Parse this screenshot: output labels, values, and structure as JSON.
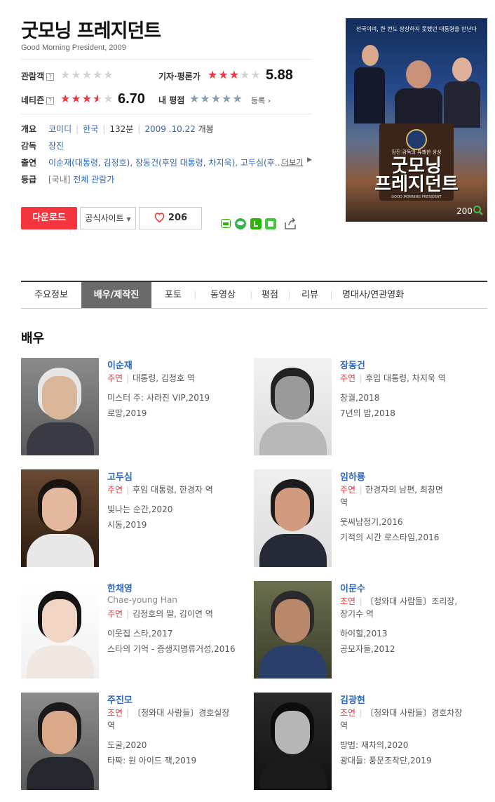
{
  "movie": {
    "title": "굿모닝 프레지던트",
    "subtitle": "Good Morning President, 2009"
  },
  "ratings": {
    "audience_label": "관람객",
    "critic_label": "기자·평론가",
    "critic_score": "5.88",
    "critic_stars": 3.0,
    "netizen_label": "네티즌",
    "netizen_score": "6.70",
    "netizen_stars": 3.5,
    "my_label": "내 평점",
    "register_label": "등록",
    "help_mark": "?"
  },
  "info": {
    "summary_key": "개요",
    "genre": "코미디",
    "country": "한국",
    "runtime": "132분",
    "release_date": "2009 .10.22",
    "release_suffix": "개봉",
    "director_key": "감독",
    "director": "장진",
    "cast_key": "출연",
    "cast_1": "이순재",
    "cast_1_role": "(대통령, 김정호),",
    "cast_2": "장동건",
    "cast_2_role": "(후임 대통령, 차지욱),",
    "cast_3": "고두심",
    "cast_3_role": "(후…",
    "more_label": "더보기",
    "grade_key": "등급",
    "grade_country": "[국내]",
    "grade": "전체 관람가"
  },
  "actions": {
    "download": "다운로드",
    "official_site": "공식사이트",
    "likes": "206"
  },
  "poster": {
    "top_text": "전국이며, 한 번도 상상하지 못했던 대통령을 만난다",
    "seal_text": "장진 감독의 유쾌한 상상",
    "title_line1": "굿모닝",
    "title_line2": "프레지던트",
    "en_title": "GOOD MORNING PRESIDENT",
    "year_partial": "200"
  },
  "tabs": [
    {
      "label": "주요정보"
    },
    {
      "label": "배우/제작진"
    },
    {
      "label": "포토"
    },
    {
      "label": "동영상"
    },
    {
      "label": "평점"
    },
    {
      "label": "리뷰"
    },
    {
      "label": "명대사/연관영화"
    }
  ],
  "section": {
    "title": "배우"
  },
  "actors": [
    {
      "name": "이순재",
      "en": "",
      "type": "주연",
      "role": "대통령, 김정호 역",
      "role2": "",
      "works": [
        "미스터 주: 사라진 VIP,2019",
        "로망,2019"
      ]
    },
    {
      "name": "장동건",
      "en": "",
      "type": "주연",
      "role": "후임 대통령, 차지욱 역",
      "role2": "",
      "works": [
        "창궐,2018",
        "7년의 밤,2018"
      ]
    },
    {
      "name": "고두심",
      "en": "",
      "type": "주연",
      "role": "후임 대통령, 한경자 역",
      "role2": "",
      "works": [
        "빛나는 순간,2020",
        "시동,2019"
      ]
    },
    {
      "name": "임하룡",
      "en": "",
      "type": "주연",
      "role": "한경자의 남편, 최창면",
      "role2": "역",
      "works": [
        "웃씨남정기,2016",
        "기적의 시간 로스타임,2016"
      ]
    },
    {
      "name": "한채영",
      "en": "Chae-young Han",
      "type": "주연",
      "role": "김정호의 딸, 김이연 역",
      "role2": "",
      "works": [
        "이웃집 스타,2017",
        "스타의 기억 - 증생지명류거성,2016"
      ]
    },
    {
      "name": "이문수",
      "en": "",
      "type": "조연",
      "role": "〔청와대 사람들〕조리장,",
      "role2": "장기수 역",
      "works": [
        "하이힐,2013",
        "공모자들,2012"
      ]
    },
    {
      "name": "주진모",
      "en": "",
      "type": "조연",
      "role": "〔청와대 사람들〕경호실장",
      "role2": "역",
      "works": [
        "도굴,2020",
        "타짜: 원 아이드 잭,2019"
      ]
    },
    {
      "name": "김광현",
      "en": "",
      "type": "조연",
      "role": "〔청와대 사람들〕경호차장",
      "role2": "역",
      "works": [
        "방법: 재차의,2020",
        "광대들: 풍문조작단,2019"
      ]
    }
  ]
}
